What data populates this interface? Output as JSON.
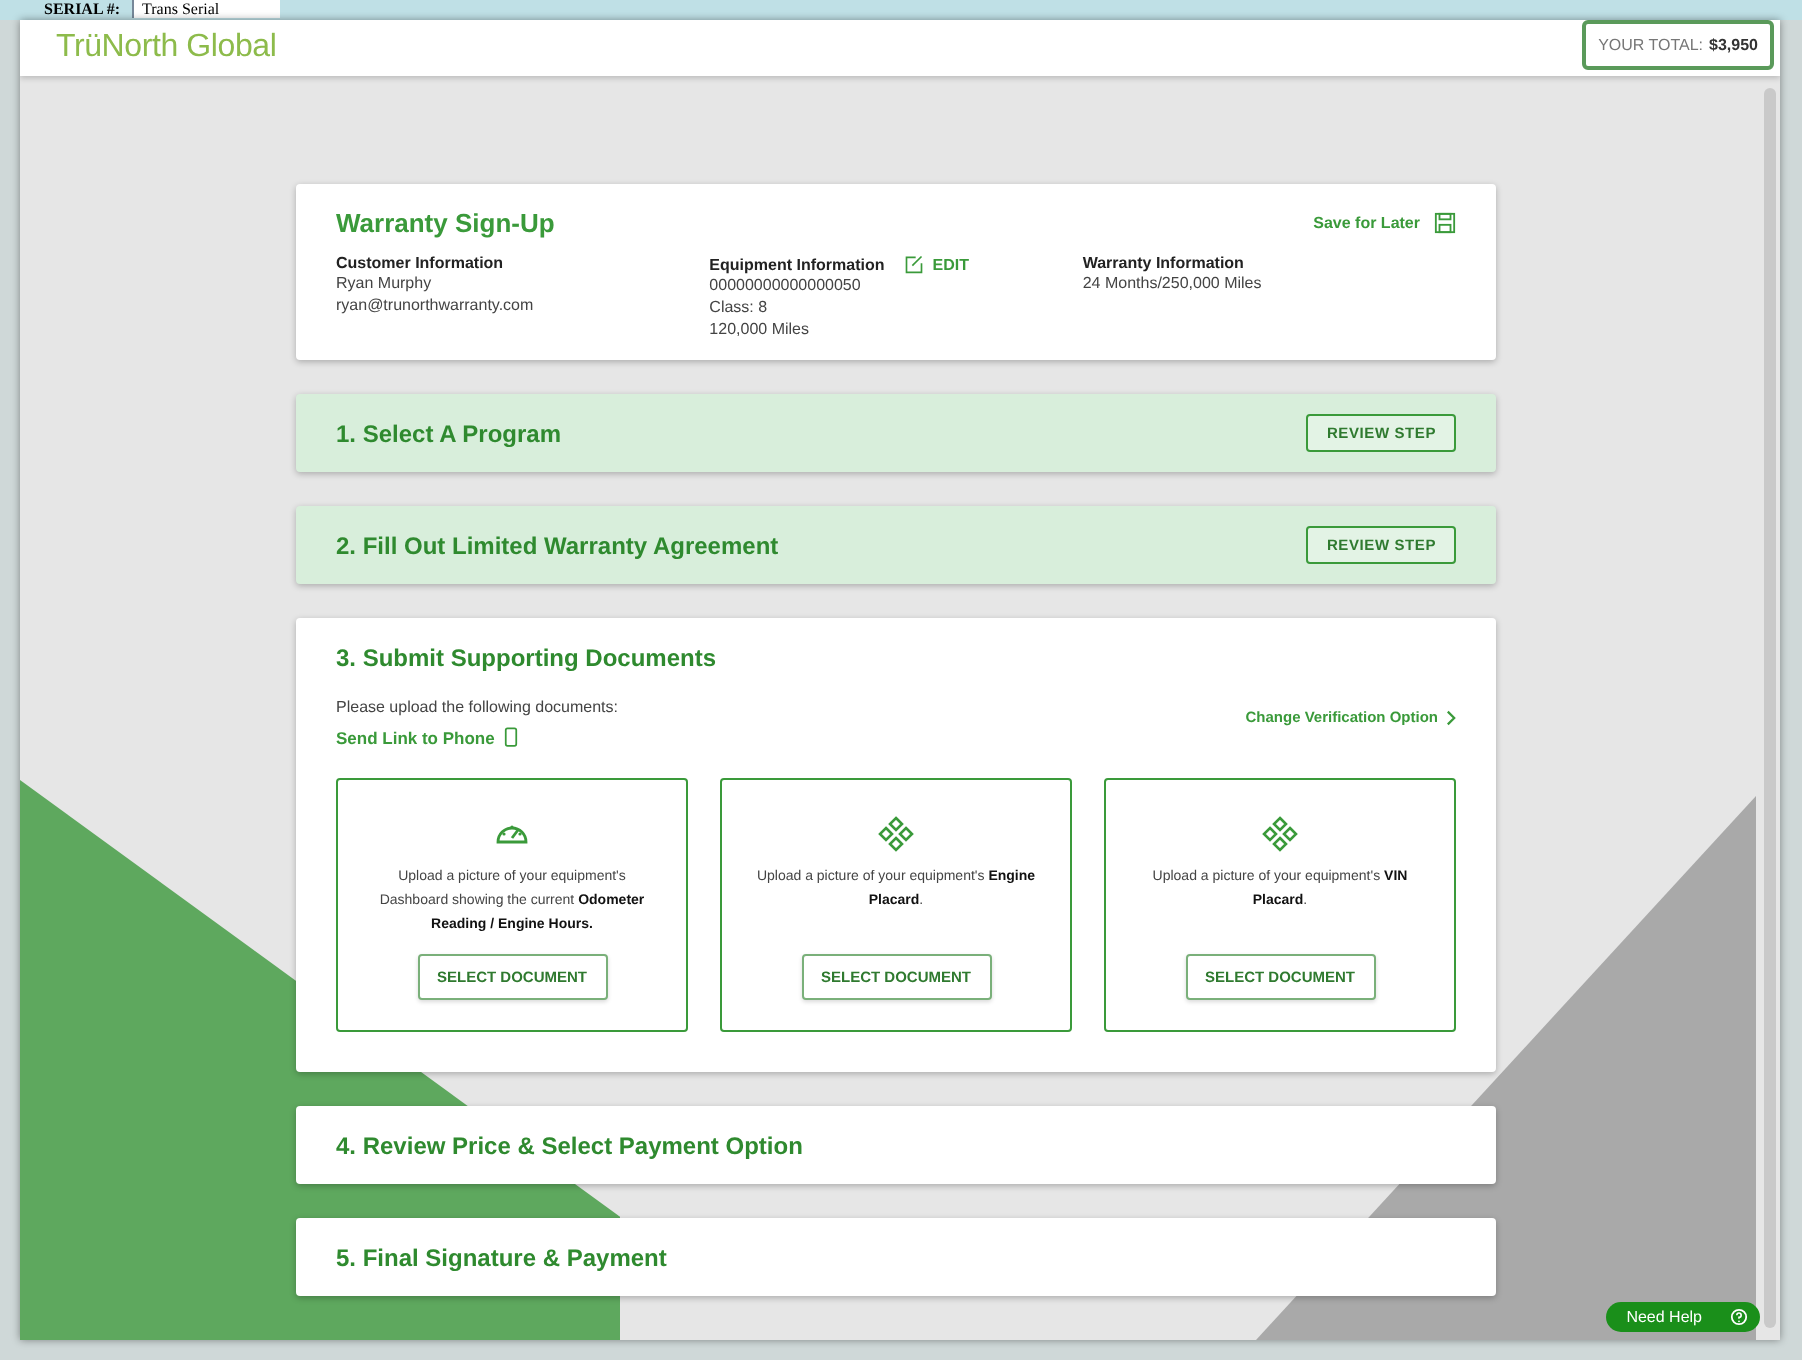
{
  "background_window": {
    "label": "SERIAL #:",
    "value": "Trans Serial"
  },
  "header": {
    "logo": "TrüNorth Global",
    "total_label": "YOUR TOTAL:",
    "total_value": "$3,950"
  },
  "summary": {
    "title": "Warranty Sign-Up",
    "save_link": "Save for Later",
    "columns": [
      {
        "heading": "Customer Information",
        "lines": [
          "Ryan Murphy",
          "ryan@trunorthwarranty.com"
        ]
      },
      {
        "heading": "Equipment Information",
        "edit": "EDIT",
        "lines": [
          "00000000000000050",
          "Class: 8",
          "120,000 Miles"
        ]
      },
      {
        "heading": "Warranty Information",
        "lines": [
          "24 Months/250,000 Miles"
        ]
      }
    ]
  },
  "steps": [
    {
      "title": "1. Select A Program",
      "kind": "completed",
      "button": "REVIEW STEP"
    },
    {
      "title": "2. Fill Out Limited Warranty Agreement",
      "kind": "completed",
      "button": "REVIEW STEP"
    },
    {
      "title": "3. Submit Supporting Documents",
      "kind": "active",
      "intro": "Please upload the following documents:",
      "send_link": "Send Link to Phone",
      "change_link": "Change Verification Option",
      "documents": [
        {
          "kind": "odometer",
          "text": "Upload a picture of your equipment's Dashboard showing the current **Odometer Reading / Engine Hours.**",
          "button": "SELECT DOCUMENT"
        },
        {
          "kind": "placard",
          "text": "Upload a picture of your equipment's **Engine Placard**.",
          "button": "SELECT DOCUMENT"
        },
        {
          "kind": "placard",
          "text": "Upload a picture of your equipment's **VIN Placard**.",
          "button": "SELECT DOCUMENT"
        }
      ]
    },
    {
      "title": "4. Review Price & Select Payment Option",
      "kind": "pending"
    },
    {
      "title": "5. Final Signature & Payment",
      "kind": "pending"
    }
  ],
  "help_button": "Need Help"
}
